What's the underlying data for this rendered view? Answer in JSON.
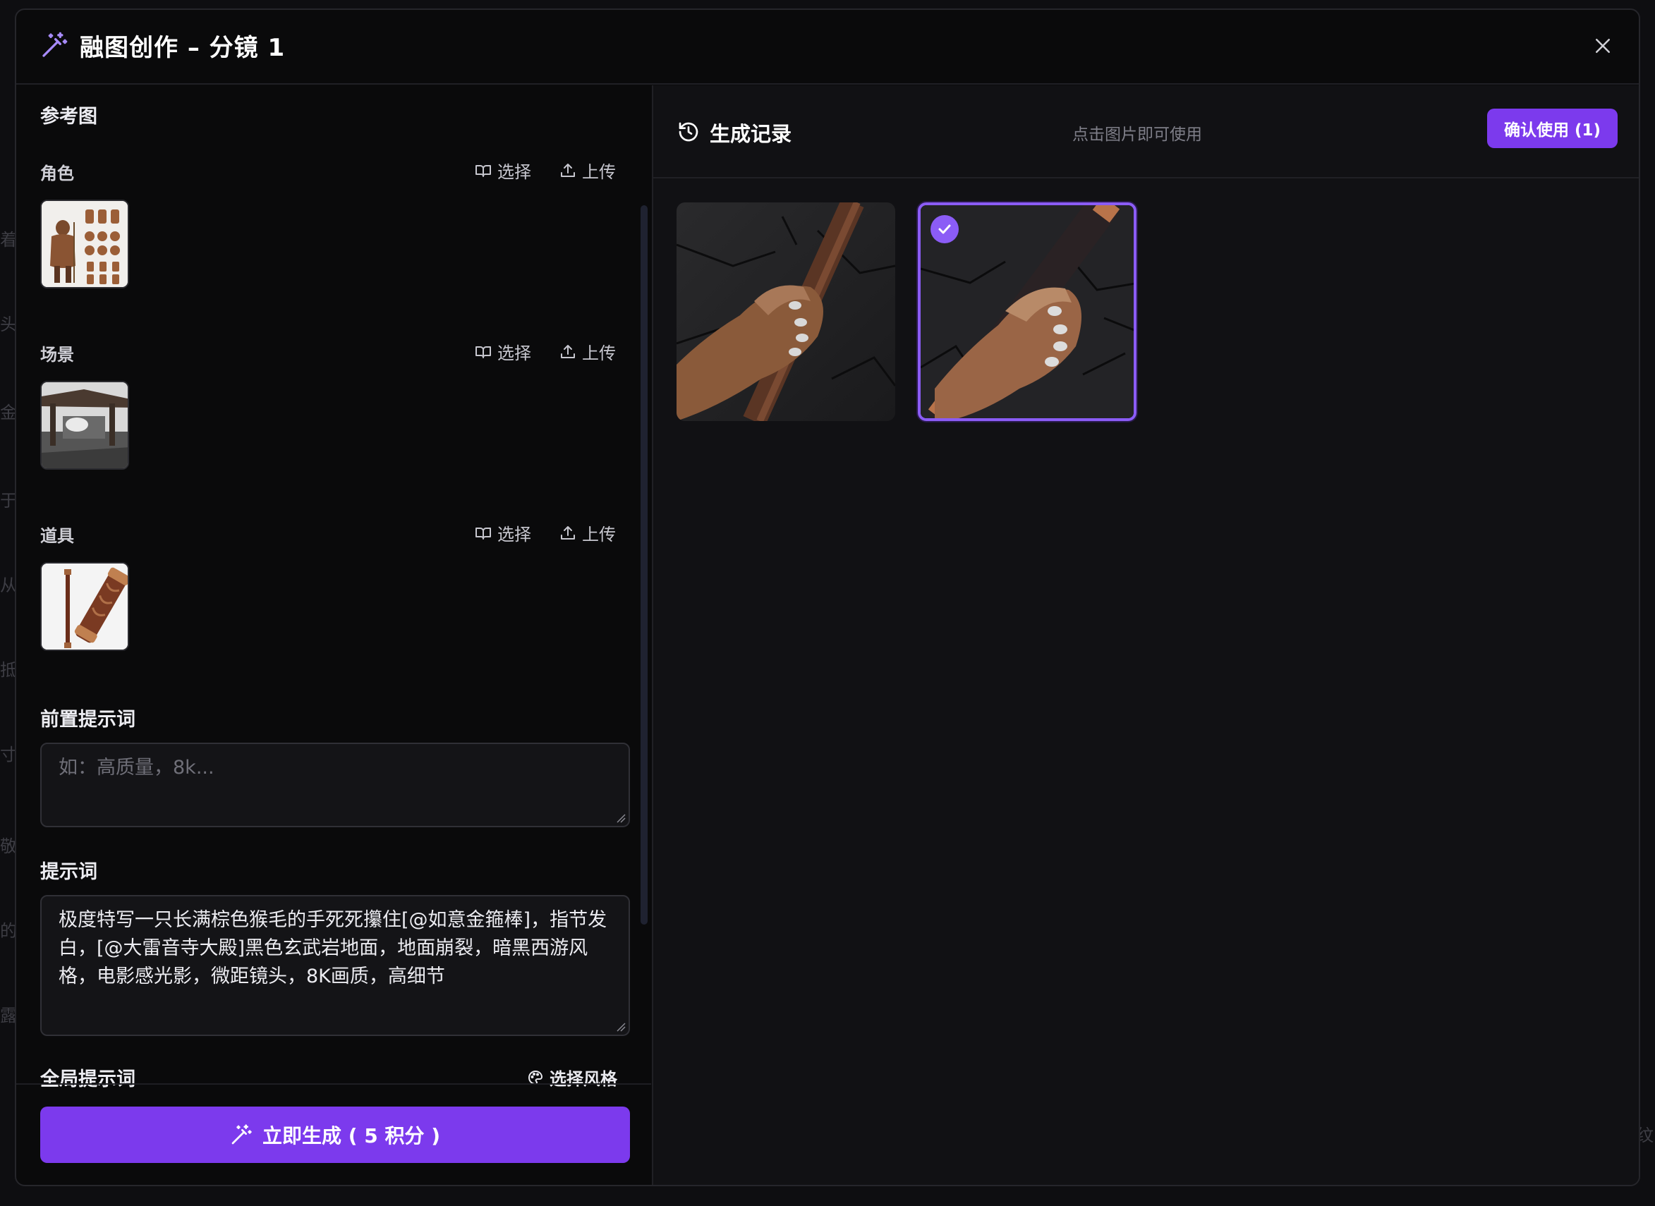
{
  "modal": {
    "title": "融图创作 – 分镜 1"
  },
  "left": {
    "reference_heading": "参考图",
    "sections": [
      {
        "label": "角色",
        "select": "选择",
        "upload": "上传"
      },
      {
        "label": "场景",
        "select": "选择",
        "upload": "上传"
      },
      {
        "label": "道具",
        "select": "选择",
        "upload": "上传"
      }
    ],
    "pre_prompt": {
      "label": "前置提示词",
      "placeholder": "如：高质量，8k..."
    },
    "prompt": {
      "label": "提示词",
      "value": "极度特写一只长满棕色猴毛的手死死攥住[@如意金箍棒]，指节发白，[@大雷音寺大殿]黑色玄武岩地面，地面崩裂，暗黑西游风格，电影感光影，微距镜头，8K画质，高细节"
    },
    "global_prompt": {
      "label": "全局提示词",
      "style_action": "选择风格"
    },
    "generate_button": "立即生成 ( 5 积分 )"
  },
  "right": {
    "title": "生成记录",
    "hint": "点击图片即可使用",
    "confirm_button": "确认使用 (1)",
    "results": [
      {
        "name": "result-1",
        "selected": false
      },
      {
        "name": "result-2",
        "selected": true
      }
    ]
  },
  "colors": {
    "accent": "#7c3aed",
    "accent_light": "#8b5cf6",
    "background": "#0a0a0b",
    "panel": "#111114"
  }
}
